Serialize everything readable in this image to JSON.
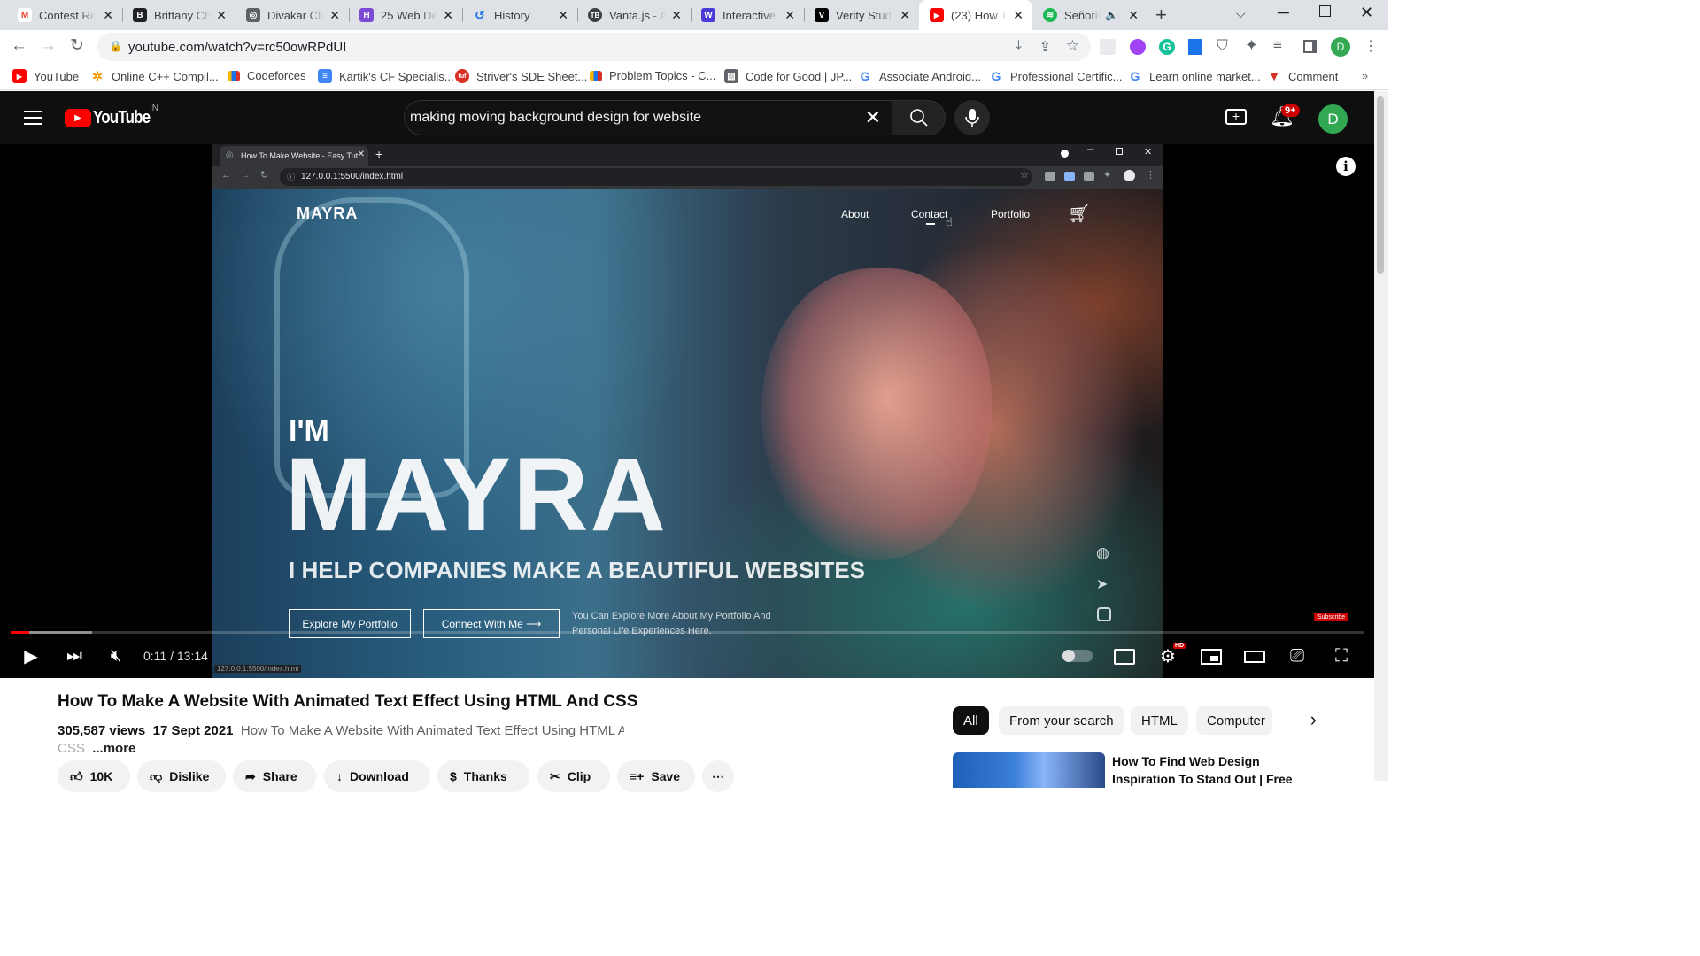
{
  "browser": {
    "tabs": [
      {
        "title": "Contest Re",
        "icon": "gmail-icon",
        "color": "#ea4335",
        "glyph": "M"
      },
      {
        "title": "Brittany Ch",
        "icon": "bootstrap-icon",
        "color": "#202124",
        "glyph": "B"
      },
      {
        "title": "Divakar Ch",
        "icon": "globe-icon",
        "color": "#5f6368",
        "glyph": "◎"
      },
      {
        "title": "25 Web De",
        "icon": "site-icon",
        "color": "#7b4bd6",
        "glyph": "H"
      },
      {
        "title": "History",
        "icon": "history-icon",
        "color": "#1a73e8",
        "glyph": "↺"
      },
      {
        "title": "Vanta.js - A",
        "icon": "vanta-icon",
        "color": "#3c4043",
        "glyph": "TB"
      },
      {
        "title": "Interactive",
        "icon": "w-icon",
        "color": "#4a3bd6",
        "glyph": "W"
      },
      {
        "title": "Verity Studi",
        "icon": "v-icon",
        "color": "#000000",
        "glyph": "V"
      },
      {
        "title": "(23) How To",
        "icon": "youtube-icon",
        "color": "#ff0000",
        "glyph": "▶"
      },
      {
        "title": "Señorit",
        "icon": "spotify-icon",
        "color": "#1db954",
        "glyph": "≋"
      }
    ],
    "url": "youtube.com/watch?v=rc50owRPdUI",
    "profile_initial": "D",
    "bookmarks": [
      {
        "label": "YouTube",
        "color": "#ff0000",
        "glyph": "▶"
      },
      {
        "label": "Online C++ Compil...",
        "color": "#f29900",
        "glyph": "✲"
      },
      {
        "label": "Codeforces",
        "color": "#1a73e8",
        "glyph": "▮"
      },
      {
        "label": "Kartik's CF Specialis...",
        "color": "#4285f4",
        "glyph": "≡"
      },
      {
        "label": "Striver's SDE Sheet...",
        "color": "#d93025",
        "glyph": "S"
      },
      {
        "label": "Problem Topics - C...",
        "color": "#1a73e8",
        "glyph": "▮"
      },
      {
        "label": "Code for Good | JP...",
        "color": "#5f6368",
        "glyph": "▧"
      },
      {
        "label": "Associate Android...",
        "color": "#4285f4",
        "glyph": "G"
      },
      {
        "label": "Professional Certific...",
        "color": "#4285f4",
        "glyph": "G"
      },
      {
        "label": "Learn online market...",
        "color": "#4285f4",
        "glyph": "G"
      },
      {
        "label": "Comment",
        "color": "#d93025",
        "glyph": "▼"
      }
    ],
    "bookmarks_more": "»"
  },
  "youtube": {
    "logo": "YouTube",
    "region": "IN",
    "search_query": "making moving background design for website",
    "notifications": "9+",
    "avatar": "D"
  },
  "player": {
    "inner_tab_title": "How To Make Website - Easy Tut",
    "inner_url": "127.0.0.1:5500/index.html",
    "site_logo": "MAYRA",
    "site_nav": [
      "About",
      "Contact",
      "Portfolio"
    ],
    "hero_small": "I'M",
    "hero_big": "MAYRA",
    "hero_tagline": "I HELP COMPANIES MAKE A BEAUTIFUL WEBSITES",
    "btn_portfolio": "Explore My Portfolio",
    "btn_connect": "Connect With Me ⟶",
    "hero_desc": "You Can Explore More About My Portfolio And Personal Life Experiences Here.",
    "status_url": "127.0.0.1:5500/index.html",
    "subscribe_badge": "Subscribe",
    "time": "0:11 / 13:14",
    "progress": 0.014,
    "buffered": 0.06,
    "hd_badge": "HD"
  },
  "video": {
    "title": "How To Make A Website With Animated Text Effect Using HTML And CSS",
    "views": "305,587 views",
    "date": "17 Sept 2021",
    "desc_line1": "How To Make A Website With Animated Text Effect Using HTML And",
    "desc_line2": "CSS",
    "more": "...more",
    "actions": [
      "10K",
      "Dislike",
      "Share",
      "Download",
      "Thanks",
      "Clip",
      "Save"
    ]
  },
  "chips": [
    "All",
    "From your search",
    "HTML",
    "Computer"
  ],
  "recommended": {
    "title_line1": "How To Find Web Design",
    "title_line2": "Inspiration To Stand Out | Free"
  }
}
